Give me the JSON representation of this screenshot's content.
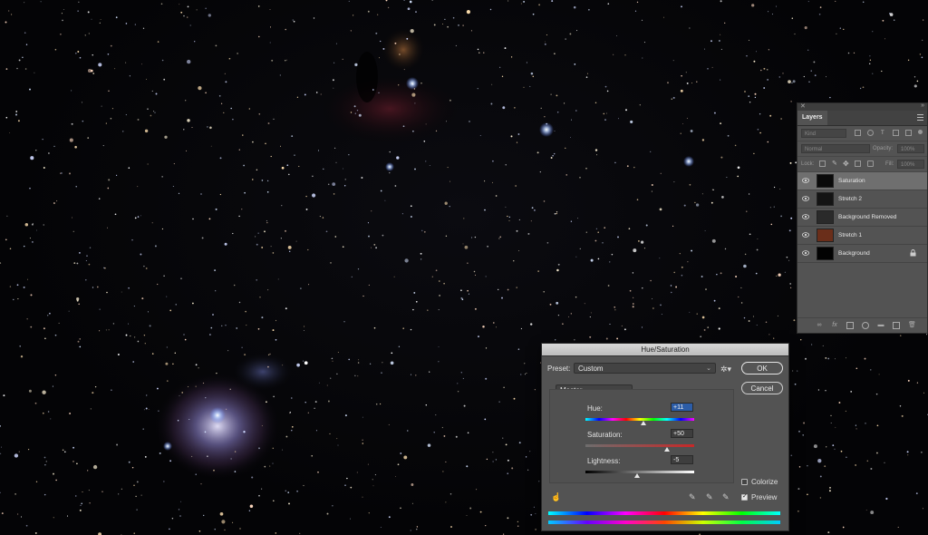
{
  "layers_panel": {
    "tab_label": "Layers",
    "filter_placeholder": "Kind",
    "blend_mode": "Normal",
    "opacity_label": "Opacity:",
    "opacity_value": "100%",
    "lock_label": "Lock:",
    "fill_label": "Fill:",
    "fill_value": "100%",
    "layers": [
      {
        "name": "Saturation",
        "selected": true,
        "thumb_color": "#0a0a0a"
      },
      {
        "name": "Stretch 2",
        "selected": false,
        "thumb_color": "#141414"
      },
      {
        "name": "Background Removed",
        "selected": false,
        "thumb_color": "#2a2a2a"
      },
      {
        "name": "Stretch 1",
        "selected": false,
        "thumb_color": "#6a2e1a"
      },
      {
        "name": "Background",
        "selected": false,
        "thumb_color": "#020202",
        "locked": true
      }
    ]
  },
  "huesat": {
    "title": "Hue/Saturation",
    "preset_label": "Preset:",
    "preset_value": "Custom",
    "channel_value": "Master",
    "ok_label": "OK",
    "cancel_label": "Cancel",
    "hue_label": "Hue:",
    "hue_value": "+11",
    "hue_level": 11,
    "saturation_label": "Saturation:",
    "saturation_value": "+50",
    "saturation_level": 50,
    "lightness_label": "Lightness:",
    "lightness_value": "-5",
    "lightness_level": -5,
    "colorize_label": "Colorize",
    "colorize_checked": false,
    "preview_label": "Preview",
    "preview_checked": true
  },
  "colors": {
    "panel_bg": "#535353",
    "selection_blue": "#2c5da8"
  }
}
